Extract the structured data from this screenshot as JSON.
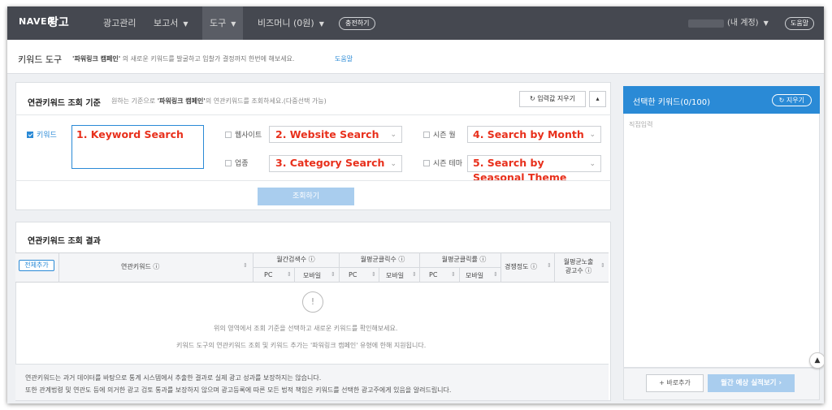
{
  "nav": {
    "logo": "NAVER",
    "logo_suffix": "광고",
    "items": [
      {
        "label": "광고관리"
      },
      {
        "label": "보고서"
      },
      {
        "label": "도구"
      },
      {
        "label": "비즈머니 (0원)"
      }
    ],
    "charge_button": "충전하기",
    "account": "(내 계정)",
    "help_button": "도움말"
  },
  "subheader": {
    "title": "키워드 도구",
    "desc_prefix": "'파워링크 캠페인'",
    "desc_rest": "의 새로운 키워드를 발굴하고 입찰가 결정까지 한번에 해보세요.",
    "help_link": "도움말"
  },
  "criteria": {
    "title": "연관키워드 조회 기준",
    "hint_prefix": "원하는 기준으로",
    "hint_campaign": "'파워링크 캠페인'",
    "hint_rest": "의 연관키워드를 조회하세요.(다중선택 가능)",
    "reset_button": "입력값 지우기",
    "keyword_label": "키워드",
    "website_label": "웹사이트",
    "category_label": "업종",
    "month_label": "시즌 월",
    "theme_label": "시즌 테마",
    "search_button": "조회하기",
    "annotations": {
      "keyword": "1. Keyword Search",
      "website": "2. Website Search",
      "category": "3. Category Search",
      "month": "4. Search by Month",
      "theme_line1": "5. Search by",
      "theme_line2": "Seasonal Theme"
    }
  },
  "results": {
    "title": "연관키워드 조회 결과",
    "add_all": "전체추가",
    "columns": {
      "keyword": "연관키워드 ⓘ",
      "monthly_search": "월간검색수 ⓘ",
      "monthly_avg_clicks": "월평균클릭수 ⓘ",
      "monthly_avg_ctr": "월평균클릭률 ⓘ",
      "competition": "경쟁정도 ⓘ",
      "ads_line1": "월평균노출",
      "ads_line2": "광고수 ⓘ",
      "pc": "PC",
      "mobile": "모바일"
    },
    "empty_line1": "위의 영역에서 조회 기준을 선택하고 새로운 키워드를 확인해보세요.",
    "empty_line2": "키워드 도구의 연관키워드 조회 및 키워드 추가는 '파워링크 캠페인' 유형에 한해 지원됩니다.",
    "note1": "연관키워드는 과거 데이터를 바탕으로 통계 시스템에서 추출한 결과로 실제 광고 성과를 보장하지는 않습니다.",
    "note2": "또한 관계법령 및 연관도 등에 의거한 광고 검토 통과를 보장하지 않으며 광고등록에 따른 모든 법적 책임은 키워드를 선택한 광고주에게 있음을 알려드립니다."
  },
  "selected": {
    "title": "선택한 키워드(0/100)",
    "clear_button": "지우기",
    "placeholder": "직접입력",
    "add_button": "+ 바로추가",
    "view_button": "월간 예상 실적보기 ›"
  },
  "colors": {
    "nav_bg": "#454850",
    "accent": "#2a8ad6",
    "annotation": "#e8301c"
  }
}
